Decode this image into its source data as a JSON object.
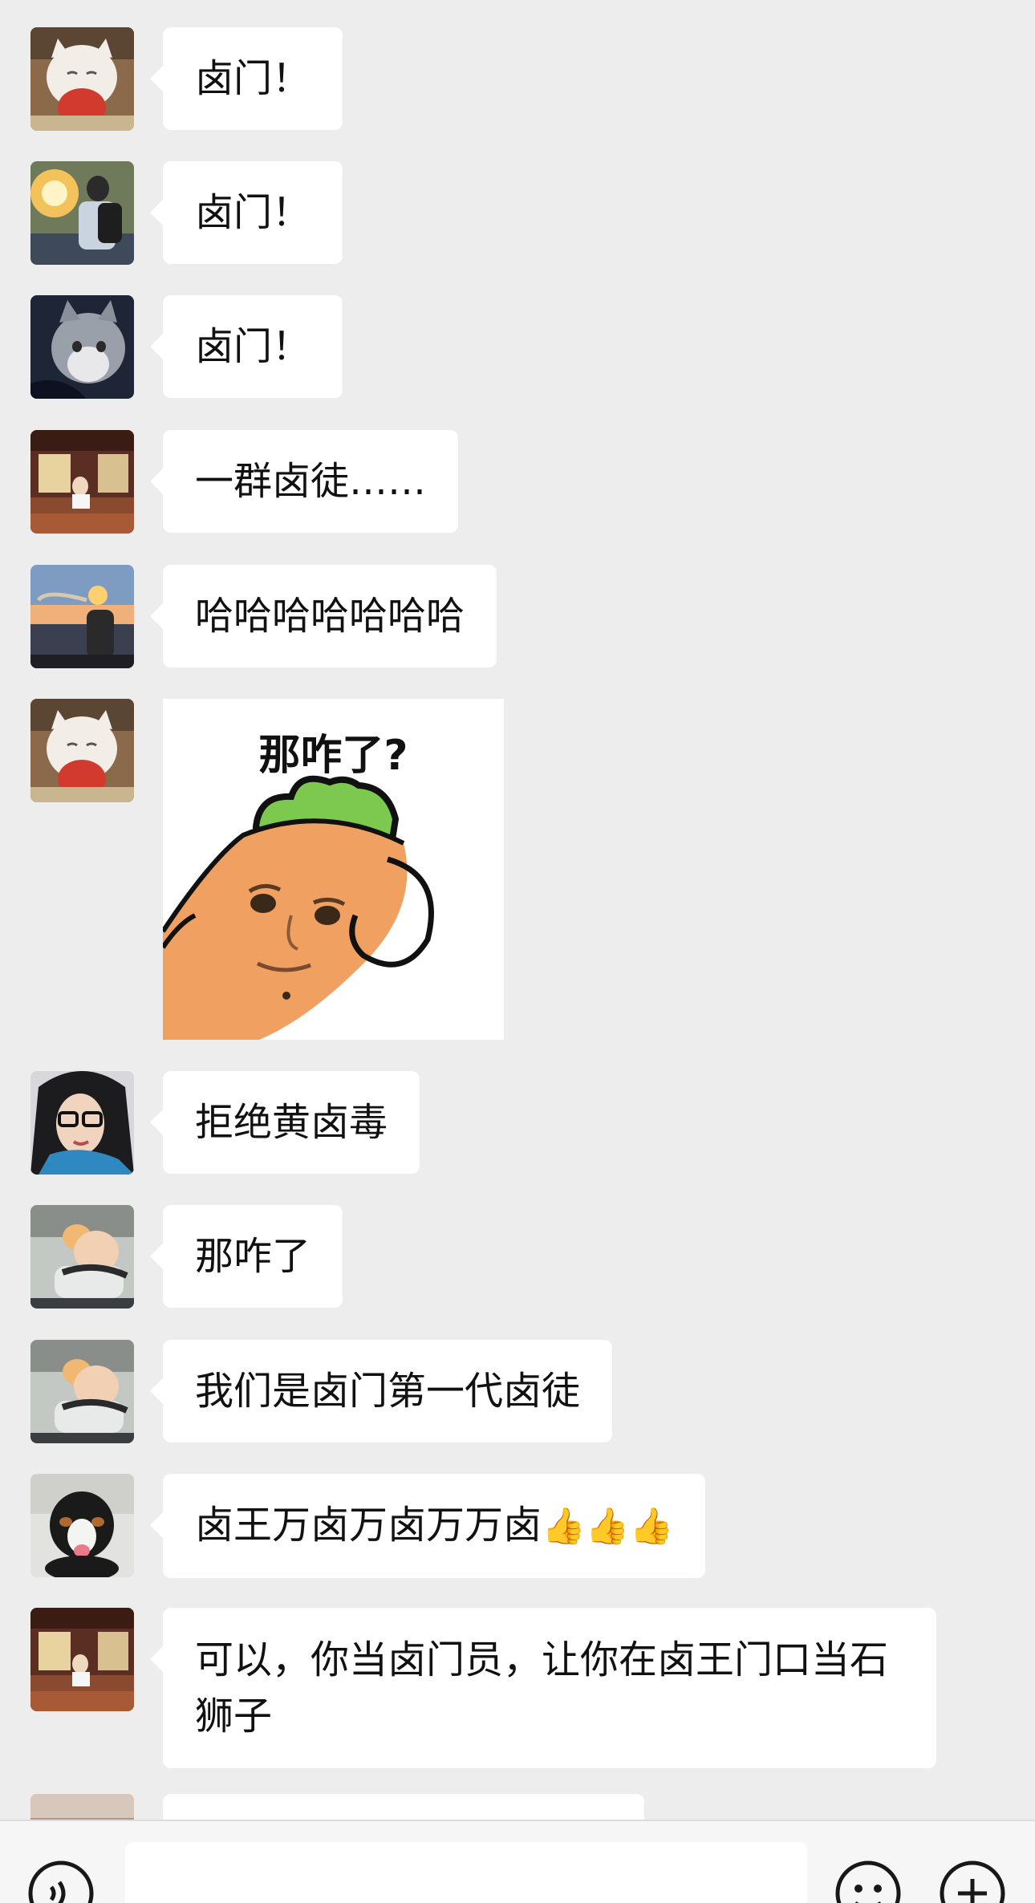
{
  "messages": [
    {
      "avatar": "white-cat-with-apple-avatar",
      "text": "卤门！"
    },
    {
      "avatar": "person-with-backpack-sunset-avatar",
      "text": "卤门！"
    },
    {
      "avatar": "grey-cat-avatar",
      "text": "卤门！"
    },
    {
      "avatar": "woman-in-wooden-house-avatar",
      "text": "一群卤徒……"
    },
    {
      "avatar": "person-by-sea-sunset-avatar",
      "text": "哈哈哈哈哈哈哈"
    },
    {
      "avatar": "white-cat-with-apple-avatar",
      "sticker_caption": "那咋了?",
      "sticker": "carrot-with-face-sticker"
    },
    {
      "avatar": "woman-with-glasses-avatar",
      "text": "拒绝黄卤毒"
    },
    {
      "avatar": "baby-drinking-avatar",
      "text": "那咋了"
    },
    {
      "avatar": "baby-drinking-avatar",
      "text": "我们是卤门第一代卤徒"
    },
    {
      "avatar": "bernese-dog-avatar",
      "text": "卤王万卤万卤万万卤",
      "emoji": "👍👍👍"
    },
    {
      "avatar": "woman-in-wooden-house-avatar",
      "text": "可以，你当卤门员，让你在卤王门口当石狮子"
    }
  ],
  "input_bar": {
    "left_icon": "voice-icon",
    "right_icons": [
      "emoji-icon",
      "plus-icon"
    ],
    "input_value": ""
  }
}
